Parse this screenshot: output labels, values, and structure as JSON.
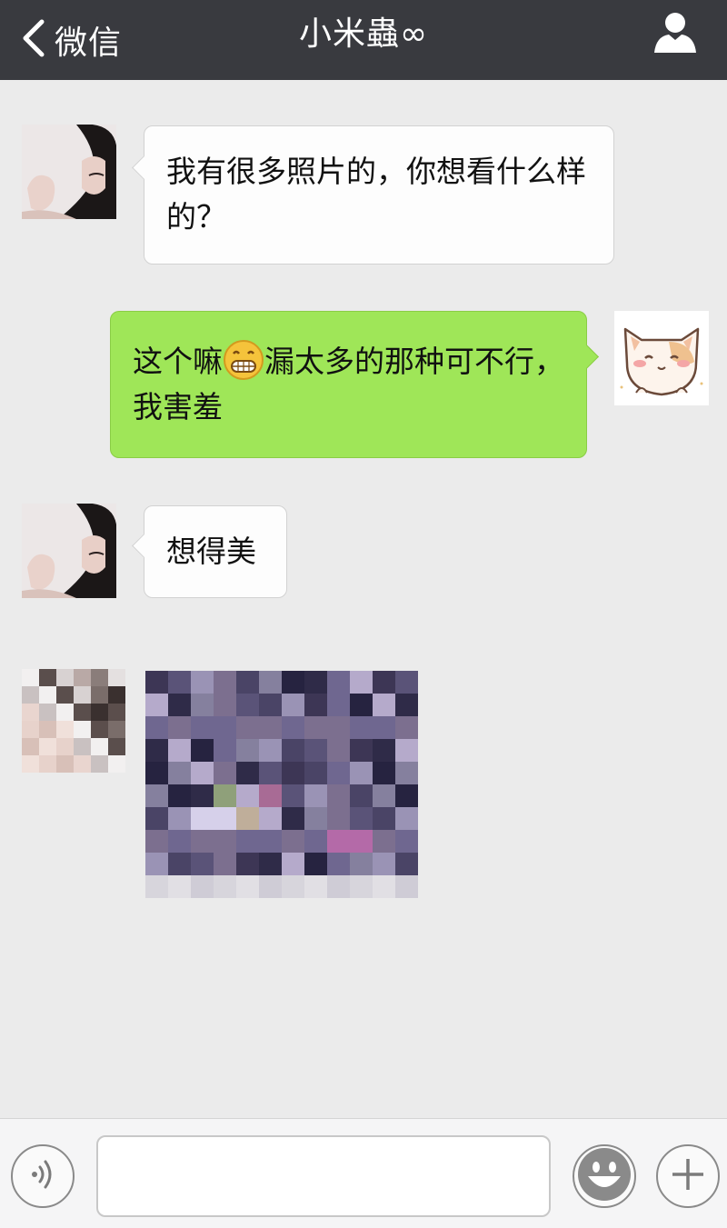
{
  "header": {
    "back_label": "微信",
    "title": "小米蟲∞"
  },
  "messages": [
    {
      "side": "incoming",
      "text": "我有很多照片的，你想看什么样的？"
    },
    {
      "side": "outgoing",
      "text_before_emoji": "这个嘛",
      "emoji": "grinning-face-emoji",
      "text_after_emoji": "漏太多的那种可不行，我害羞"
    },
    {
      "side": "incoming",
      "text": "想得美"
    },
    {
      "side": "incoming",
      "type": "image",
      "image": "pixelated-photo"
    }
  ],
  "input": {
    "value": "",
    "placeholder": ""
  },
  "icons": {
    "back": "chevron-left-icon",
    "profile": "person-icon",
    "voice": "voice-icon",
    "emoji": "smiley-icon",
    "more": "plus-icon"
  },
  "colors": {
    "header_bg": "#393a3f",
    "chat_bg": "#ebebeb",
    "outgoing_bubble": "#9fe658",
    "incoming_bubble": "#fdfdfd"
  }
}
